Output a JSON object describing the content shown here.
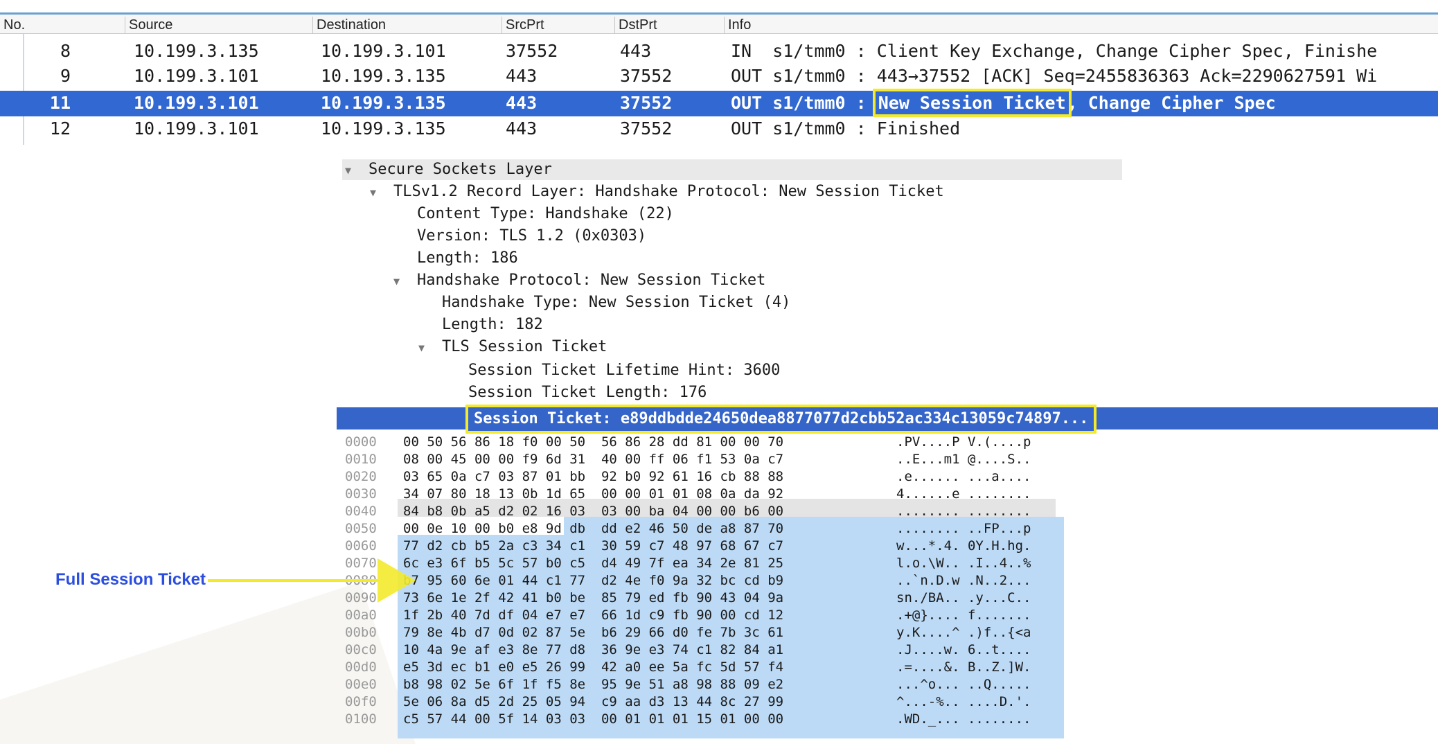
{
  "packet_list": {
    "columns": [
      "No.",
      "Source",
      "Destination",
      "SrcPrt",
      "DstPrt",
      "Info"
    ],
    "rows": [
      {
        "no": "8",
        "src": "10.199.3.135",
        "dst": "10.199.3.101",
        "sport": "37552",
        "dport": "443",
        "info": "IN  s1/tmm0 : Client Key Exchange, Change Cipher Spec, Finishe"
      },
      {
        "no": "9",
        "src": "10.199.3.101",
        "dst": "10.199.3.135",
        "sport": "443",
        "dport": "37552",
        "info": "OUT s1/tmm0 : 443→37552 [ACK] Seq=2455836363 Ack=2290627591 Wi"
      },
      {
        "no": "11",
        "src": "10.199.3.101",
        "dst": "10.199.3.135",
        "sport": "443",
        "dport": "37552",
        "info_prefix": "OUT s1/tmm0 : ",
        "info_highlight": "New Session Ticket",
        "info_suffix": ", Change Cipher Spec",
        "selected": true
      },
      {
        "no": "12",
        "src": "10.199.3.101",
        "dst": "10.199.3.135",
        "sport": "443",
        "dport": "37552",
        "info": "OUT s1/tmm0 : Finished"
      }
    ]
  },
  "details": {
    "ssl": "Secure Sockets Layer",
    "record": "TLSv1.2 Record Layer: Handshake Protocol: New Session Ticket",
    "content_type": "Content Type: Handshake (22)",
    "version": "Version: TLS 1.2 (0x0303)",
    "length": "Length: 186",
    "handshake": "Handshake Protocol: New Session Ticket",
    "hs_type": "Handshake Type: New Session Ticket (4)",
    "hs_length": "Length: 182",
    "tls_ticket": "TLS Session Ticket",
    "lifetime": "Session Ticket Lifetime Hint: 3600",
    "ticket_len": "Session Ticket Length: 176",
    "ticket": "Session Ticket: e89ddbdde24650dea8877077d2cbb52ac334c13059c74897..."
  },
  "hex_dump": [
    {
      "off": "0000",
      "hex": "00 50 56 86 18 f0 00 50  56 86 28 dd 81 00 00 70",
      "ascii": ".PV....P V.(....p"
    },
    {
      "off": "0010",
      "hex": "08 00 45 00 00 f9 6d 31  40 00 ff 06 f1 53 0a c7",
      "ascii": "..E...m1 @....S.."
    },
    {
      "off": "0020",
      "hex": "03 65 0a c7 03 87 01 bb  92 b0 92 61 16 cb 88 88",
      "ascii": ".e...... ...a...."
    },
    {
      "off": "0030",
      "hex": "34 07 80 18 13 0b 1d 65  00 00 01 01 08 0a da 92",
      "ascii": "4......e ........"
    },
    {
      "off": "0040",
      "hex": "84 b8 0b a5 d2 02 16 03  03 00 ba 04 00 00 b6 00",
      "ascii": "........ ........"
    },
    {
      "off": "0050",
      "hex": "00 0e 10 00 b0 e8 9d db  dd e2 46 50 de a8 87 70",
      "ascii": "........ ..FP...p"
    },
    {
      "off": "0060",
      "hex": "77 d2 cb b5 2a c3 34 c1  30 59 c7 48 97 68 67 c7",
      "ascii": "w...*.4. 0Y.H.hg."
    },
    {
      "off": "0070",
      "hex": "6c e3 6f b5 5c 57 b0 c5  d4 49 7f ea 34 2e 81 25",
      "ascii": "l.o.\\W.. .I..4..%"
    },
    {
      "off": "0080",
      "hex": "b7 95 60 6e 01 44 c1 77  d2 4e f0 9a 32 bc cd b9",
      "ascii": "..`n.D.w .N..2..."
    },
    {
      "off": "0090",
      "hex": "73 6e 1e 2f 42 41 b0 be  85 79 ed fb 90 43 04 9a",
      "ascii": "sn./BA.. .y...C.."
    },
    {
      "off": "00a0",
      "hex": "1f 2b 40 7d df 04 e7 e7  66 1d c9 fb 90 00 cd 12",
      "ascii": ".+@}.... f......."
    },
    {
      "off": "00b0",
      "hex": "79 8e 4b d7 0d 02 87 5e  b6 29 66 d0 fe 7b 3c 61",
      "ascii": "y.K....^ .)f..{<a"
    },
    {
      "off": "00c0",
      "hex": "10 4a 9e af e3 8e 77 d8  36 9e e3 74 c1 82 84 a1",
      "ascii": ".J....w. 6..t...."
    },
    {
      "off": "00d0",
      "hex": "e5 3d ec b1 e0 e5 26 99  42 a0 ee 5a fc 5d 57 f4",
      "ascii": ".=....&. B..Z.]W."
    },
    {
      "off": "00e0",
      "hex": "b8 98 02 5e 6f 1f f5 8e  95 9e 51 a8 98 88 09 e2",
      "ascii": "...^o... ..Q....."
    },
    {
      "off": "00f0",
      "hex": "5e 06 8a d5 2d 25 05 94  c9 aa d3 13 44 8c 27 99",
      "ascii": "^...-%.. ....D.'."
    },
    {
      "off": "0100",
      "hex": "c5 57 44 00 5f 14 03 03  00 01 01 01 15 01 00 00",
      "ascii": ".WD._... ........"
    }
  ],
  "annotation": {
    "label": "Full Session Ticket"
  },
  "colors": {
    "selection": "#3268d1",
    "highlight_box": "#f3ea2c",
    "hex_highlight": "#bcdaf6",
    "annotation_text": "#2b4de0"
  }
}
